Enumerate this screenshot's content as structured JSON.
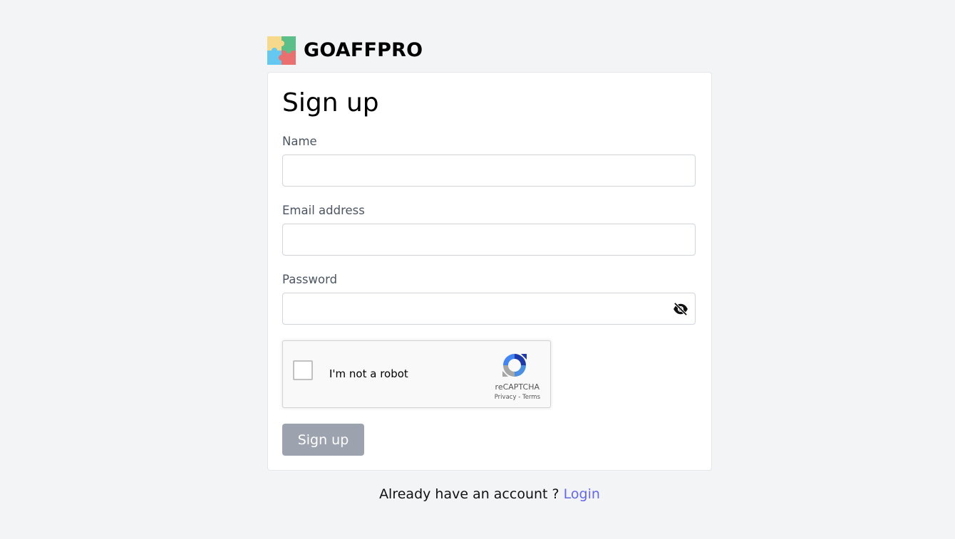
{
  "brand": {
    "name": "GOAFFPRO",
    "logo_icon": "puzzle-logo-icon",
    "logo_colors": [
      "#f6d98b",
      "#5bbf8a",
      "#64c8f0",
      "#ea6f6f"
    ]
  },
  "form": {
    "title": "Sign up",
    "fields": {
      "name": {
        "label": "Name",
        "value": "",
        "placeholder": ""
      },
      "email": {
        "label": "Email address",
        "value": "",
        "placeholder": ""
      },
      "password": {
        "label": "Password",
        "value": "",
        "placeholder": "",
        "toggle_icon": "eye-slash-icon"
      }
    },
    "recaptcha": {
      "checkbox_label": "I'm not a robot",
      "brand": "reCAPTCHA",
      "privacy": "Privacy",
      "separator": "-",
      "terms": "Terms",
      "checked": false
    },
    "submit_label": "Sign up",
    "submit_color": "#9ca3af"
  },
  "footer": {
    "prompt": "Already have an account ?",
    "login_label": "Login",
    "link_color": "#6366f1"
  }
}
